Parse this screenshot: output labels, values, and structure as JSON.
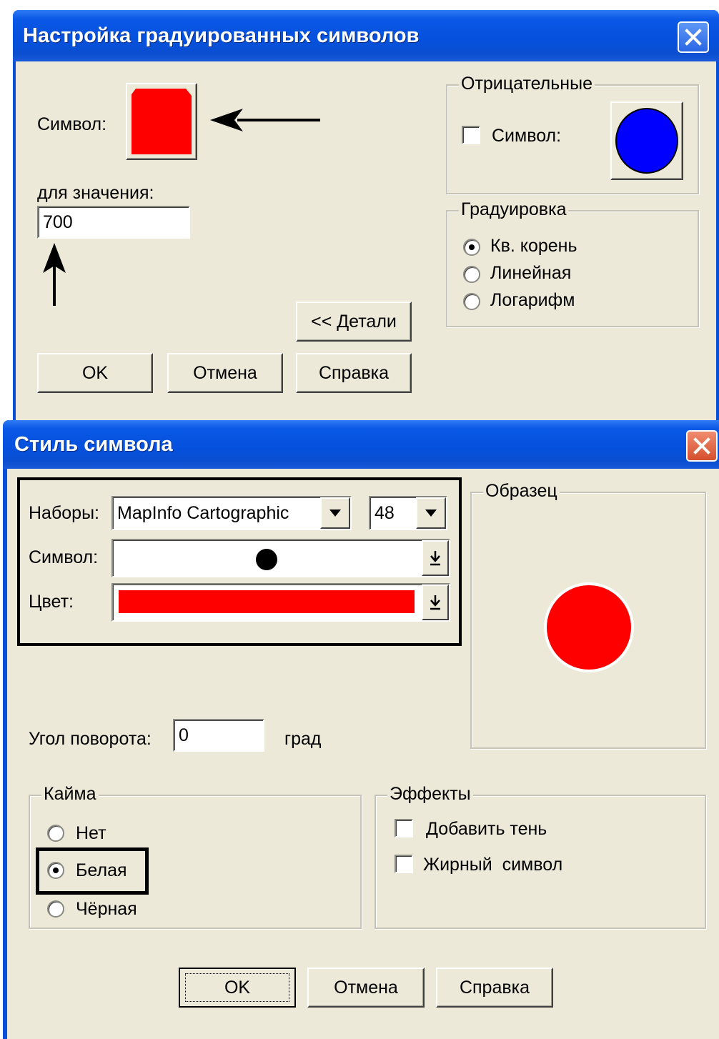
{
  "graduated_dialog": {
    "title": "Настройка градуированных символов",
    "symbol_label": "Символ:",
    "symbol_color": "#ff0000",
    "value_label": "для значения:",
    "value": "700",
    "negative": {
      "legend": "Отрицательные",
      "symbol_label": "Символ:",
      "checked": false,
      "symbol_color": "#0000ff"
    },
    "scaling": {
      "legend": "Градуировка",
      "options": [
        "Кв. корень",
        "Линейная",
        "Логарифм"
      ],
      "selected": "Кв. корень"
    },
    "details_button": "<< Детали",
    "ok_button": "OK",
    "cancel_button": "Отмена",
    "help_button": "Справка"
  },
  "symbol_style_dialog": {
    "title": "Стиль символа",
    "font_label": "Наборы:",
    "font_value": "MapInfo Cartographic",
    "size_value": "48",
    "symbol_label": "Символ:",
    "color_label": "Цвет:",
    "color_value": "#ff0000",
    "sample_legend": "Образец",
    "rotation_label": "Угол поворота:",
    "rotation_value": "0",
    "rotation_unit": "град",
    "border": {
      "legend": "Кайма",
      "options": [
        "Нет",
        "Белая",
        "Чёрная"
      ],
      "selected": "Белая"
    },
    "effects": {
      "legend": "Эффекты",
      "shadow_label": "Добавить тень",
      "bold_label": "Жирный  символ",
      "shadow_checked": false,
      "bold_checked": false
    },
    "ok_button": "OK",
    "cancel_button": "Отмена",
    "help_button": "Справка"
  },
  "colors": {
    "titlebar": "#0550dc",
    "face": "#ece9d8",
    "close_blue": "#3c7bf0",
    "close_red": "#e06a4c"
  }
}
